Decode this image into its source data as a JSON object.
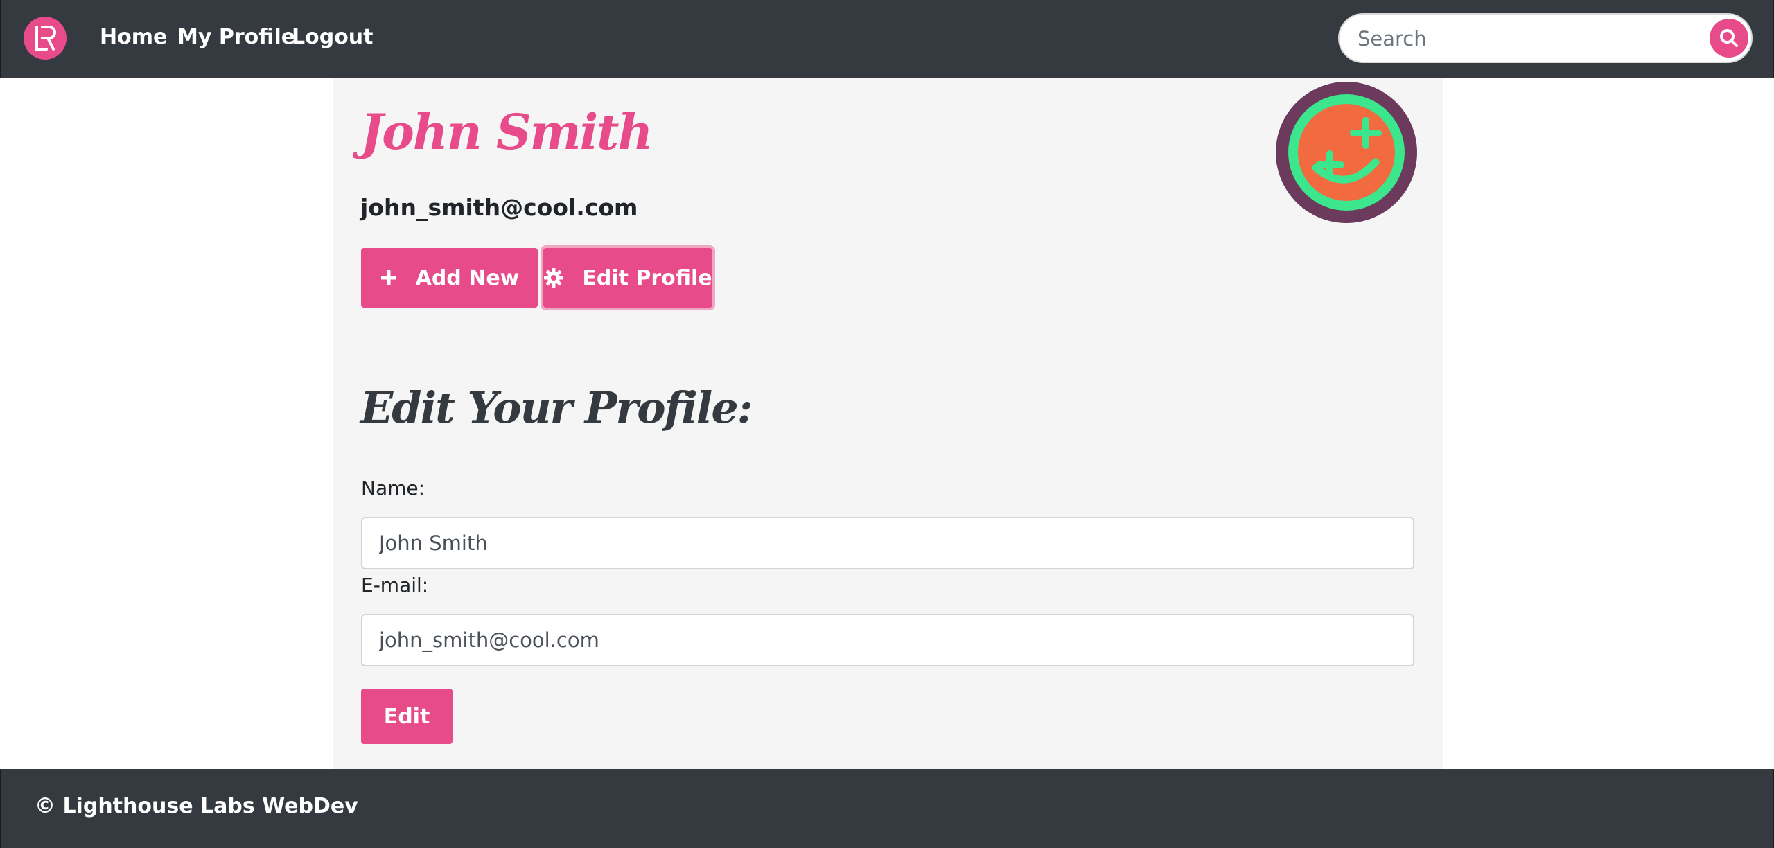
{
  "navbar": {
    "brand_icon": "lr-logo-icon",
    "links": [
      "Home",
      "My Profile",
      "Logout"
    ],
    "search_placeholder": "Search",
    "search_icon": "search-icon"
  },
  "profile": {
    "name": "John Smith",
    "email": "john_smith@cool.com",
    "avatar_icon": "smiley-avatar-icon"
  },
  "actions": {
    "add_new_label": "Add New",
    "add_new_icon": "plus-icon",
    "edit_profile_label": "Edit Profile",
    "edit_profile_icon": "gear-icon"
  },
  "form": {
    "title": "Edit Your Profile:",
    "name_label": "Name:",
    "name_value": "John Smith",
    "email_label": "E-mail:",
    "email_value": "john_smith@cool.com",
    "submit_label": "Edit"
  },
  "footer": {
    "text": "© Lighthouse Labs WebDev"
  },
  "colors": {
    "accent": "#e84b8a",
    "navbar": "#343a40",
    "panel": "#f5f5f5",
    "heading_dark": "#343a40",
    "avatar_ring": "#6b3a5d",
    "avatar_green": "#3ce68c",
    "avatar_orange": "#f26a3f"
  }
}
